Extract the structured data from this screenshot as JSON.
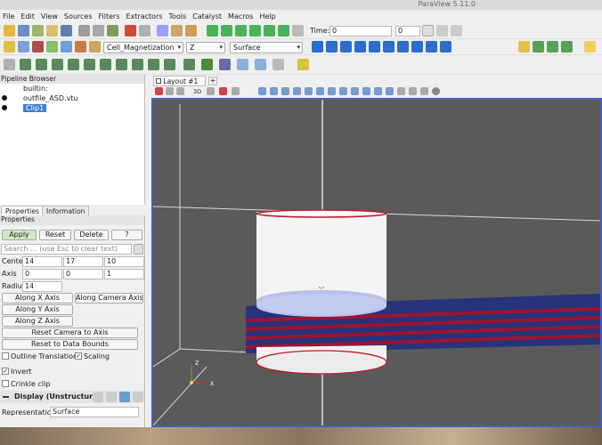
{
  "window": {
    "title": "ParaView 5.11.0"
  },
  "menu": [
    "File",
    "Edit",
    "View",
    "Sources",
    "Filters",
    "Extractors",
    "Tools",
    "Catalyst",
    "Macros",
    "Help"
  ],
  "toolbar1": {
    "time_label": "Time:",
    "time_value": "0",
    "frame_value": "0"
  },
  "toolbar2": {
    "array_name": "Cell_Magnetization",
    "component": "Z",
    "representation": "Surface"
  },
  "pipeline": {
    "title": "Pipeline Browser",
    "items": [
      "builtin:",
      "outfile_ASD.vtu",
      "Clip1"
    ]
  },
  "tabs": {
    "properties": "Properties",
    "information": "Information"
  },
  "properties": {
    "section": "Properties",
    "apply": "Apply",
    "reset": "Reset",
    "delete": "Delete",
    "help": "?",
    "search_placeholder": "Search ... (use Esc to clear text)",
    "center_label": "Center",
    "center": [
      "14",
      "17",
      "10"
    ],
    "axis_label": "Axis",
    "axis": [
      "0",
      "0",
      "1"
    ],
    "radius_label": "Radius",
    "radius": "14",
    "along_x": "Along X Axis",
    "along_camera": "Along Camera Axis",
    "along_y": "Along Y Axis",
    "along_z": "Along Z Axis",
    "reset_camera": "Reset Camera to Axis",
    "reset_bounds": "Reset to Data Bounds",
    "outline_translation": "Outline Translation",
    "scaling": "Scaling",
    "invert": "Invert",
    "crinkle": "Crinkle clip",
    "display_section": "Display (Unstructured",
    "representation_label": "Representation",
    "representation_value": "Surface"
  },
  "layout": {
    "tab": "Layout #1",
    "view_3d": "3D"
  },
  "axes": {
    "x": "X",
    "z": "Z"
  },
  "colors": {
    "selection": "#3d7dd1",
    "viewport_bg": "#5a5a5a",
    "slab_blue": "#27337a",
    "slab_red": "#9c1530"
  }
}
